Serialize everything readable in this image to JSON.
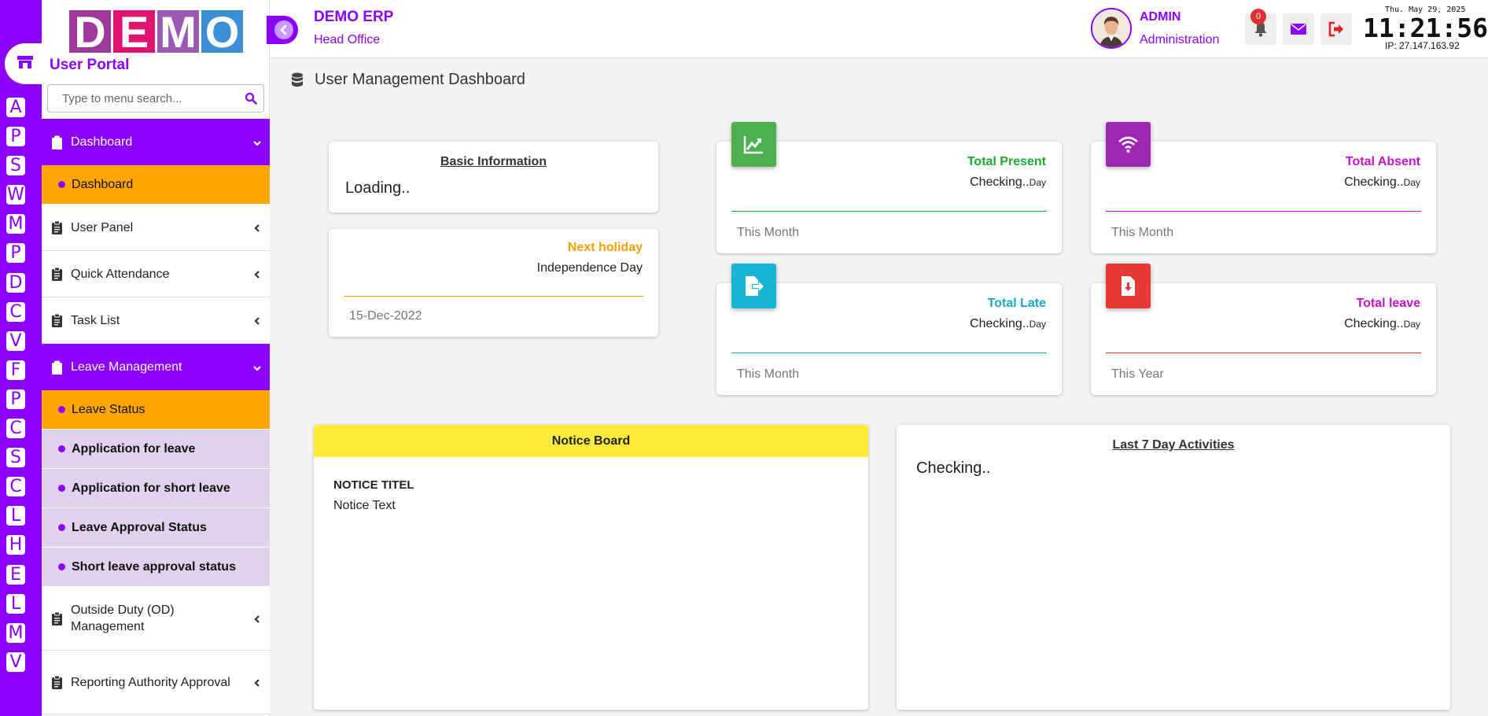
{
  "brand": {
    "logo_letters": [
      "D",
      "E",
      "M",
      "O"
    ],
    "logo_colors": [
      "#a0389a",
      "#e2136e",
      "#9b59b6",
      "#3a8fd6"
    ],
    "accent": "#8b00ff",
    "portal_title": "User Portal"
  },
  "rail": {
    "letters": [
      "A",
      "P",
      "S",
      "W",
      "M",
      "P",
      "D",
      "C",
      "V",
      "F",
      "P",
      "C",
      "S",
      "C",
      "L",
      "H",
      "E",
      "L",
      "M",
      "V"
    ]
  },
  "sidebar": {
    "search_placeholder": "Type to menu search...",
    "menu": [
      {
        "label": "Dashboard",
        "active": true,
        "expanded": true,
        "sub": [
          {
            "label": "Dashboard",
            "current": true
          }
        ]
      },
      {
        "label": "User Panel",
        "expanded": false
      },
      {
        "label": "Quick Attendance",
        "expanded": false
      },
      {
        "label": "Task List",
        "expanded": false
      },
      {
        "label": "Leave Management",
        "active": true,
        "expanded": true,
        "sub": [
          {
            "label": "Leave Status",
            "current": true
          },
          {
            "label": "Application for leave"
          },
          {
            "label": "Application for short leave"
          },
          {
            "label": "Leave Approval Status"
          },
          {
            "label": "Short leave approval status"
          }
        ]
      },
      {
        "label": "Outside Duty (OD) Management",
        "expanded": false
      },
      {
        "label": "Reporting Authority Approval",
        "expanded": false
      }
    ]
  },
  "header": {
    "app_title": "DEMO ERP",
    "app_subtitle": "Head Office",
    "user_name": "ADMIN",
    "user_role": "Administration",
    "notification_count": "0",
    "clock_date": "Thu. May 29, 2025",
    "clock_time": "11:21:56",
    "ip_text": "IP: 27.147.163.92"
  },
  "page": {
    "title": "User Management Dashboard"
  },
  "basic_info": {
    "title": "Basic Information",
    "text": "Loading.."
  },
  "holiday": {
    "label": "Next holiday",
    "value": "Independence Day",
    "date": "15-Dec-2022",
    "color": "#f5a000"
  },
  "stats": [
    {
      "label": "Total Present",
      "value": "Checking..",
      "unit": "Day",
      "footer": "This Month",
      "color": "#1aab2c",
      "icon_bg": "#4caf50",
      "icon": "chart-up-icon"
    },
    {
      "label": "Total Absent",
      "value": "Checking..",
      "unit": "Day",
      "footer": "This Month",
      "color": "#c710c9",
      "icon_bg": "#9c27b0",
      "icon": "wifi-icon"
    },
    {
      "label": "Total Late",
      "value": "Checking..",
      "unit": "Day",
      "footer": "This Month",
      "color": "#14a8c8",
      "icon_bg": "#17b5d3",
      "icon": "file-export-icon"
    },
    {
      "label": "Total leave",
      "value": "Checking..",
      "unit": "Day",
      "footer": "This Year",
      "color": "#c710c9",
      "icon_bg": "#e53935",
      "icon": "file-download-icon",
      "line_color": "#e03030"
    }
  ],
  "notice_board": {
    "title": "Notice Board",
    "notice_title": "NOTICE TITEL",
    "notice_text": "Notice Text",
    "header_color": "#ffeb3b"
  },
  "activities": {
    "title": "Last 7 Day Activities",
    "text": "Checking.."
  }
}
